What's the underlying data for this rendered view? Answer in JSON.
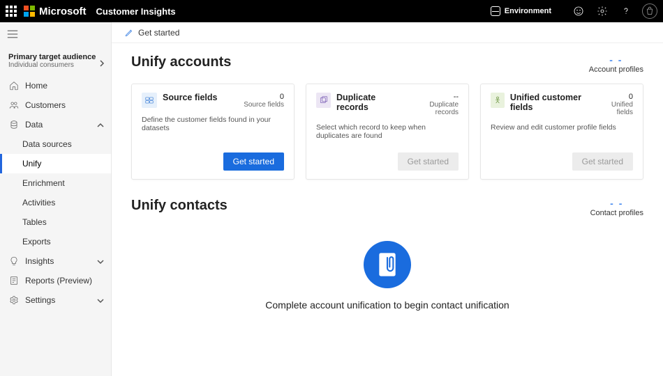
{
  "header": {
    "brand": "Microsoft",
    "product": "Customer Insights",
    "environment_label": "Environment"
  },
  "sidebar": {
    "audience_title": "Primary target audience",
    "audience_value": "Individual consumers",
    "items": {
      "home": "Home",
      "customers": "Customers",
      "data": "Data",
      "insights": "Insights",
      "reports": "Reports (Preview)",
      "settings": "Settings"
    },
    "data_children": {
      "data_sources": "Data sources",
      "unify": "Unify",
      "enrichment": "Enrichment",
      "activities": "Activities",
      "tables": "Tables",
      "exports": "Exports"
    }
  },
  "commandbar": {
    "get_started": "Get started"
  },
  "sections": {
    "accounts": {
      "title": "Unify accounts",
      "profiles_label": "Account profiles",
      "profiles_value": "- -"
    },
    "contacts": {
      "title": "Unify contacts",
      "profiles_label": "Contact profiles",
      "profiles_value": "- -",
      "empty_message": "Complete account unification to begin contact unification"
    }
  },
  "cards": [
    {
      "title": "Source fields",
      "metric_value": "0",
      "metric_label": "Source fields",
      "description": "Define the customer fields found in your datasets",
      "button": "Get started",
      "button_state": "primary",
      "icon_bg": "#e6f0fb",
      "icon_stroke": "#3d7ed6"
    },
    {
      "title": "Duplicate records",
      "metric_value": "--",
      "metric_label": "Duplicate records",
      "description": "Select which record to keep when duplicates are found",
      "button": "Get started",
      "button_state": "disabled",
      "icon_bg": "#ece6f4",
      "icon_stroke": "#7a5db5"
    },
    {
      "title": "Unified customer fields",
      "metric_value": "0",
      "metric_label": "Unified fields",
      "description": "Review and edit customer profile fields",
      "button": "Get started",
      "button_state": "disabled",
      "icon_bg": "#e9f2dd",
      "icon_stroke": "#5e8a2f"
    }
  ]
}
